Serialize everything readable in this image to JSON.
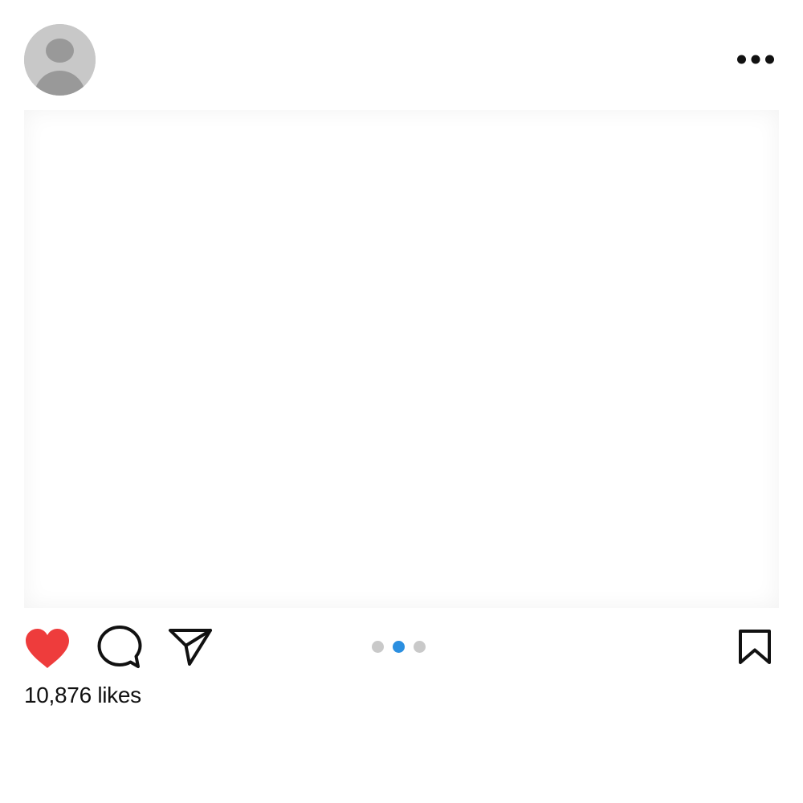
{
  "header": {
    "avatar_icon": "user-silhouette-icon",
    "more_icon": "more-horizontal-icon"
  },
  "post": {
    "media_placeholder": true
  },
  "actions": {
    "like_icon": "heart-icon",
    "liked": true,
    "comment_icon": "comment-bubble-icon",
    "share_icon": "paper-plane-icon",
    "bookmark_icon": "bookmark-icon"
  },
  "pagination": {
    "total": 3,
    "active_index": 1
  },
  "likes": {
    "text": "10,876 likes"
  },
  "colors": {
    "like_red": "#ee3c3c",
    "active_dot": "#2b8fe0",
    "inactive_dot": "#c9c9c9",
    "avatar_bg": "#c8c8c8",
    "avatar_figure": "#999999",
    "icon_stroke": "#111111"
  }
}
